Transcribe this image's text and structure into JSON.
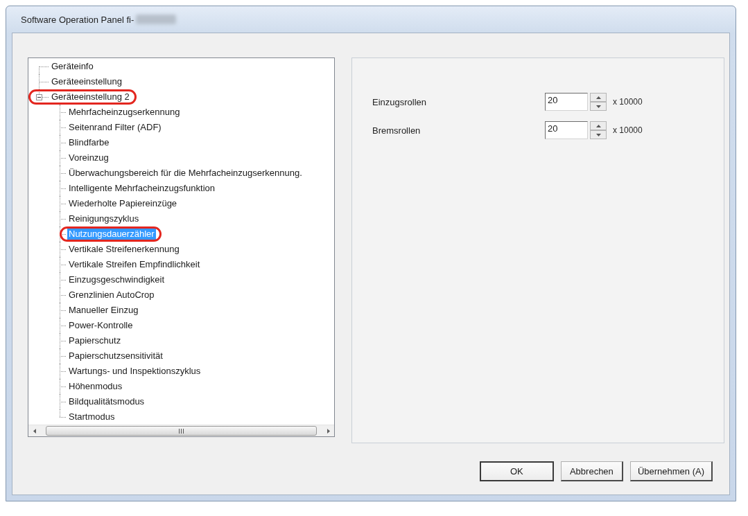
{
  "window": {
    "title": "Software Operation Panel fi-"
  },
  "tree": {
    "items": [
      {
        "label": "Geräteinfo",
        "selected": false,
        "circled": false
      },
      {
        "label": "Geräteeinstellung",
        "selected": false,
        "circled": false
      },
      {
        "label": "Geräteeinstellung 2",
        "selected": false,
        "circled": true,
        "expanded": true,
        "children": [
          {
            "label": "Mehrfacheinzugserkennung",
            "selected": false,
            "circled": false
          },
          {
            "label": "Seitenrand Filter (ADF)",
            "selected": false,
            "circled": false
          },
          {
            "label": "Blindfarbe",
            "selected": false,
            "circled": false
          },
          {
            "label": "Voreinzug",
            "selected": false,
            "circled": false
          },
          {
            "label": "Überwachungsbereich für die Mehrfacheinzugserkennung.",
            "selected": false,
            "circled": false
          },
          {
            "label": "Intelligente Mehrfacheinzugsfunktion",
            "selected": false,
            "circled": false
          },
          {
            "label": "Wiederholte Papiereinzüge",
            "selected": false,
            "circled": false
          },
          {
            "label": "Reinigungszyklus",
            "selected": false,
            "circled": false
          },
          {
            "label": "Nutzungsdauerzähler",
            "selected": true,
            "circled": true
          },
          {
            "label": "Vertikale Streifenerkennung",
            "selected": false,
            "circled": false
          },
          {
            "label": "Vertikale Streifen Empfindlichkeit",
            "selected": false,
            "circled": false
          },
          {
            "label": "Einzugsgeschwindigkeit",
            "selected": false,
            "circled": false
          },
          {
            "label": "Grenzlinien AutoCrop",
            "selected": false,
            "circled": false
          },
          {
            "label": "Manueller Einzug",
            "selected": false,
            "circled": false
          },
          {
            "label": "Power-Kontrolle",
            "selected": false,
            "circled": false
          },
          {
            "label": "Papierschutz",
            "selected": false,
            "circled": false
          },
          {
            "label": "Papierschutzsensitivität",
            "selected": false,
            "circled": false
          },
          {
            "label": "Wartungs- und Inspektionszyklus",
            "selected": false,
            "circled": false
          },
          {
            "label": "Höhenmodus",
            "selected": false,
            "circled": false
          },
          {
            "label": "Bildqualitätsmodus",
            "selected": false,
            "circled": false
          },
          {
            "label": "Startmodus",
            "selected": false,
            "circled": false
          }
        ]
      }
    ]
  },
  "settings": [
    {
      "label": "Einzugsrollen",
      "value": "20",
      "unit": "x 10000"
    },
    {
      "label": "Bremsrollen",
      "value": "20",
      "unit": "x 10000"
    }
  ],
  "buttons": [
    {
      "label": "OK",
      "default": true
    },
    {
      "label": "Abbrechen",
      "default": false
    },
    {
      "label": "Übernehmen (A)",
      "default": false
    }
  ]
}
